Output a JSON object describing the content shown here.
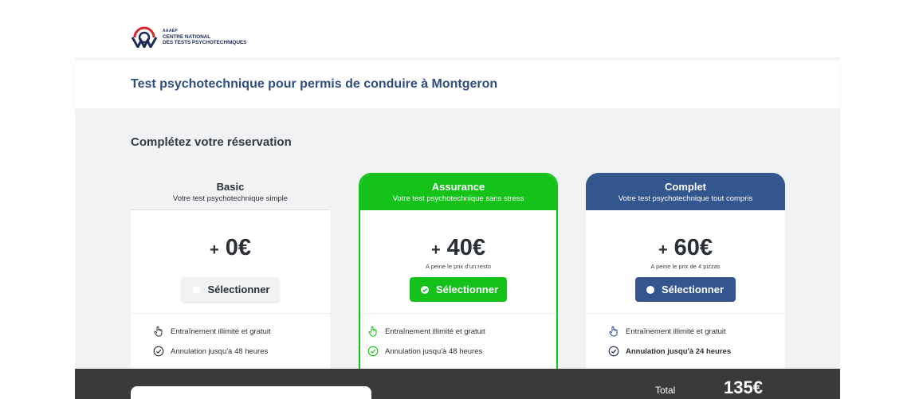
{
  "logo": {
    "small": "AAAEP",
    "line1": "CENTRE NATIONAL",
    "line2": "DES TESTS PSYCHOTECHNIQUES",
    "icon": "aaaep-logo-icon",
    "colors": {
      "red": "#d8262c",
      "blue": "#1d2a55"
    }
  },
  "header": {
    "title": "Test psychotechnique pour permis de conduire à Montgeron"
  },
  "main": {
    "section_title": "Complétez votre réservation"
  },
  "plans": [
    {
      "name": "Basic",
      "subtitle": "Votre test psychotechnique simple",
      "plus": "+",
      "price": "0€",
      "note": "",
      "button_label": "Sélectionner",
      "selected": false,
      "features": [
        "Entraînement illimité et gratuit",
        "Annulation jusqu'à 48 heures"
      ],
      "icons": [
        "hand-pointer-icon",
        "check-circle-icon"
      ]
    },
    {
      "name": "Assurance",
      "subtitle": "Votre test psychotechnique sans stress",
      "plus": "+",
      "price": "40€",
      "note": "A peine le prix d'un resto",
      "button_label": "Sélectionner",
      "selected": true,
      "features": [
        "Entraînement illimité et gratuit",
        "Annulation jusqu'à 48 heures"
      ],
      "icons": [
        "hand-pointer-icon",
        "check-circle-icon"
      ]
    },
    {
      "name": "Complet",
      "subtitle": "Votre test psychotechnique tout compris",
      "plus": "+",
      "price": "60€",
      "note": "A peine le prix de 4 pizzas",
      "button_label": "Sélectionner",
      "selected": false,
      "features": [
        "Entraînement illimité et gratuit",
        "Annulation jusqu'à 24 heures"
      ],
      "icons": [
        "hand-pointer-icon",
        "check-circle-icon"
      ]
    }
  ],
  "footer": {
    "total_label": "Total",
    "total_value": "135€"
  },
  "colors": {
    "primary_blue": "#34568e",
    "title_blue": "#2f4d7e",
    "green": "#14c21a",
    "dark_bar": "#3a3a3a",
    "gray_bg": "#f1f2f4"
  }
}
